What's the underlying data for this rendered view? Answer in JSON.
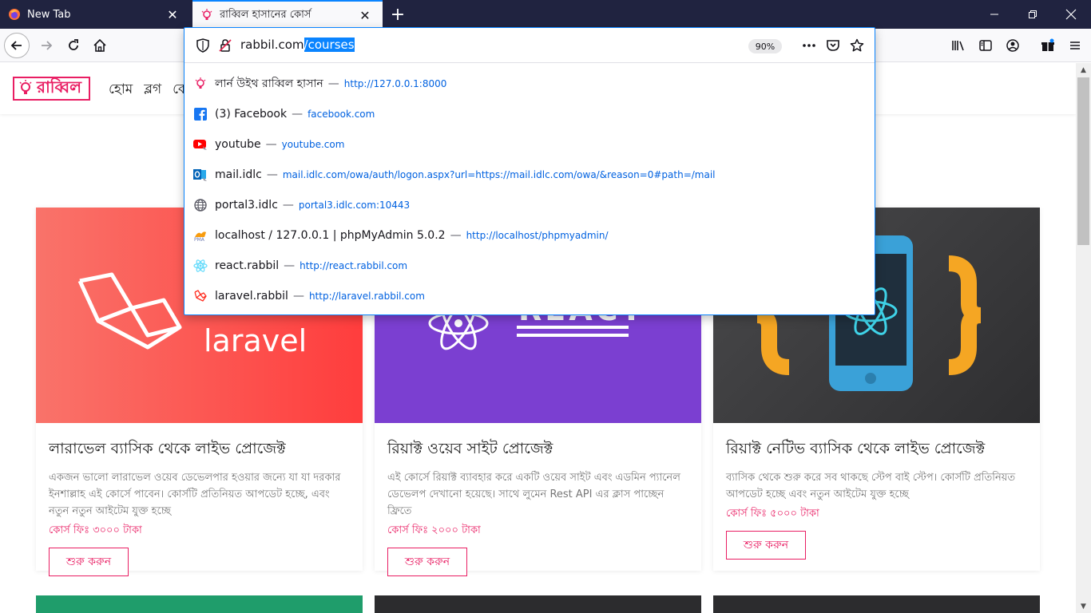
{
  "tabs": [
    {
      "title": "New Tab",
      "favicon": "firefox-icon"
    },
    {
      "title": "রাব্বিল হাসানের কোর্স",
      "favicon": "bulb-icon"
    }
  ],
  "urlbar": {
    "host": "rabbil.com",
    "path": "/courses",
    "zoom": "90%"
  },
  "suggestions": [
    {
      "title": "লার্ন উইথ রাব্বিল হাসান",
      "url": "http://127.0.0.1:8000",
      "icon": "bulb-icon"
    },
    {
      "title": "(3) Facebook",
      "url": "facebook.com",
      "icon": "facebook-icon"
    },
    {
      "title": "youtube",
      "url": "youtube.com",
      "icon": "youtube-icon"
    },
    {
      "title": "mail.idlc",
      "url": "mail.idlc.com/owa/auth/logon.aspx?url=https://mail.idlc.com/owa/&reason=0#path=/mail",
      "icon": "outlook-icon"
    },
    {
      "title": "portal3.idlc",
      "url": "portal3.idlc.com:10443",
      "icon": "globe-icon"
    },
    {
      "title": "localhost / 127.0.0.1 | phpMyAdmin 5.0.2",
      "url": "http://localhost/phpmyadmin/",
      "icon": "phpmyadmin-icon"
    },
    {
      "title": "react.rabbil",
      "url": "http://react.rabbil.com",
      "icon": "react-icon"
    },
    {
      "title": "laravel.rabbil",
      "url": "http://laravel.rabbil.com",
      "icon": "laravel-icon"
    }
  ],
  "site": {
    "logo": "রাব্বিল",
    "nav": [
      "হোম",
      "ব্লগ",
      "কো"
    ]
  },
  "cards": [
    {
      "image_text": "laravel",
      "title": "লারাভেল ব্যাসিক থেকে লাইভ প্রোজেক্ট",
      "desc": "একজন ভালো লারাভেল ওয়েব ডেভেলপার হওয়ার জন্যে যা যা দরকার ইনশাল্লাহ এই কোর্সে পাবেন। কোর্সটি প্রতিনিয়ত আপডেট হচ্ছে, এবং নতুন নতুন আইটেম যুক্ত হচ্ছে",
      "fee": "কোর্স ফিঃ ৩০০০ টাকা",
      "button": "শুরু করুন"
    },
    {
      "image_text": "REACT",
      "title": "রিয়াক্ট ওয়েব সাইট প্রোজেক্ট",
      "desc": "এই কোর্সে রিয়াক্ট ব্যাবহার করে একটি ওয়েব সাইট এবং এডমিন প্যানেল ডেভেলপ দেখানো হয়েছে। সাথে লুমেন Rest API এর ক্লাস পাচ্ছেন ফ্রিতে",
      "fee": "কোর্স ফিঃ ২০০০ টাকা",
      "button": "শুরু করুন"
    },
    {
      "image_text": "",
      "title": "রিয়াক্ট নেটিভ ব্যাসিক থেকে লাইভ প্রোজেক্ট",
      "desc": "ব্যাসিক থেকে শুরু করে সব থাকছে স্টেপ বাই স্টেপ। কোর্সটি প্রতিনিয়ত আপডেট হচ্ছে এবং নতুন আইটেম যুক্ত হচ্ছে",
      "fee": "কোর্স ফিঃ ৫০০০ টাকা",
      "button": "শুরু করুন"
    }
  ],
  "colors": {
    "brand": "#e91e63",
    "tabstrip": "#202340",
    "focus": "#0a84ff",
    "laravel_gradient": [
      "#f9736a",
      "#ff3d3d"
    ],
    "react_bg": "#7b3fd1",
    "native_bg": "#3b3b3d"
  }
}
